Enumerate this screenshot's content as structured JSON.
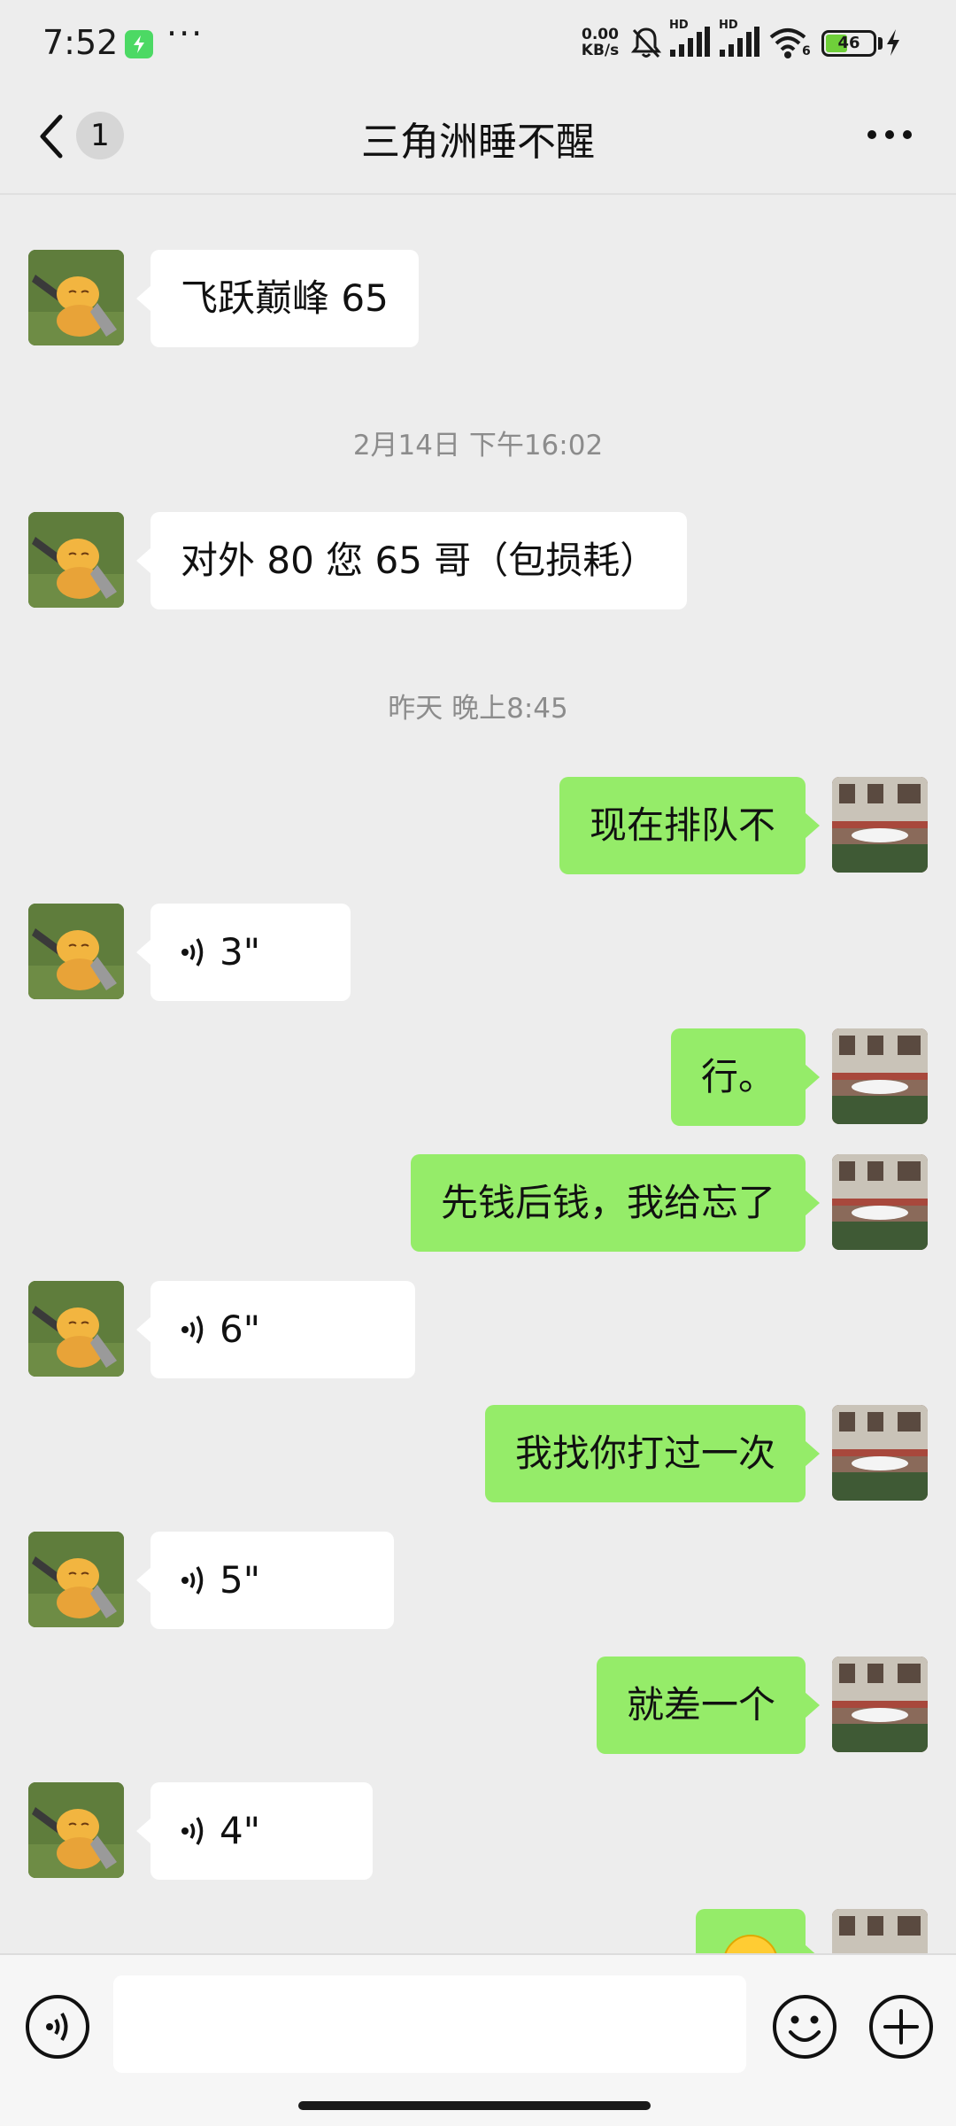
{
  "status_bar": {
    "time": "7:52",
    "more": "···",
    "net_speed_value": "0.00",
    "net_speed_unit": "KB/s",
    "signal_label_1": "HD",
    "signal_label_2": "HD",
    "wifi_label": "6",
    "battery_level": "46",
    "battery_fraction": 0.46,
    "icons": [
      "charging-app-icon",
      "mute-bell-icon",
      "signal-hd-icon",
      "signal-hd-icon",
      "wifi-icon",
      "battery-icon",
      "charging-bolt-icon"
    ]
  },
  "nav": {
    "unread_count": "1",
    "title": "三角洲睡不醒",
    "icons": [
      "back-chevron-icon",
      "more-dots-icon"
    ]
  },
  "messages": [
    {
      "type": "text",
      "direction": "in",
      "text": "飞跃巅峰 65"
    },
    {
      "type": "time",
      "text": "2月14日 下午16:02"
    },
    {
      "type": "text",
      "direction": "in",
      "text": "对外 80 您 65 哥（包损耗）"
    },
    {
      "type": "time",
      "text": "昨天 晚上8:45"
    },
    {
      "type": "text",
      "direction": "out",
      "text": "现在排队不"
    },
    {
      "type": "voice",
      "direction": "in",
      "duration": "3\""
    },
    {
      "type": "text",
      "direction": "out",
      "text": "行。"
    },
    {
      "type": "text",
      "direction": "out",
      "text": "先钱后钱，我给忘了"
    },
    {
      "type": "voice",
      "direction": "in",
      "duration": "6\""
    },
    {
      "type": "text",
      "direction": "out",
      "text": "我找你打过一次"
    },
    {
      "type": "voice",
      "direction": "in",
      "duration": "5\""
    },
    {
      "type": "text",
      "direction": "out",
      "text": "就差一个"
    },
    {
      "type": "voice",
      "direction": "in",
      "duration": "4\""
    },
    {
      "type": "emoji",
      "direction": "out",
      "icon": "emoji-face-icon"
    }
  ],
  "input_bar": {
    "message_value": "",
    "icons": [
      "voice-input-icon",
      "emoji-icon",
      "plus-icon"
    ]
  },
  "colors": {
    "background": "#ededed",
    "bubble_out": "#95ec69",
    "bubble_in": "#ffffff",
    "timestamp_text": "#8c8c8c",
    "battery_fill": "#6fcf3a"
  }
}
